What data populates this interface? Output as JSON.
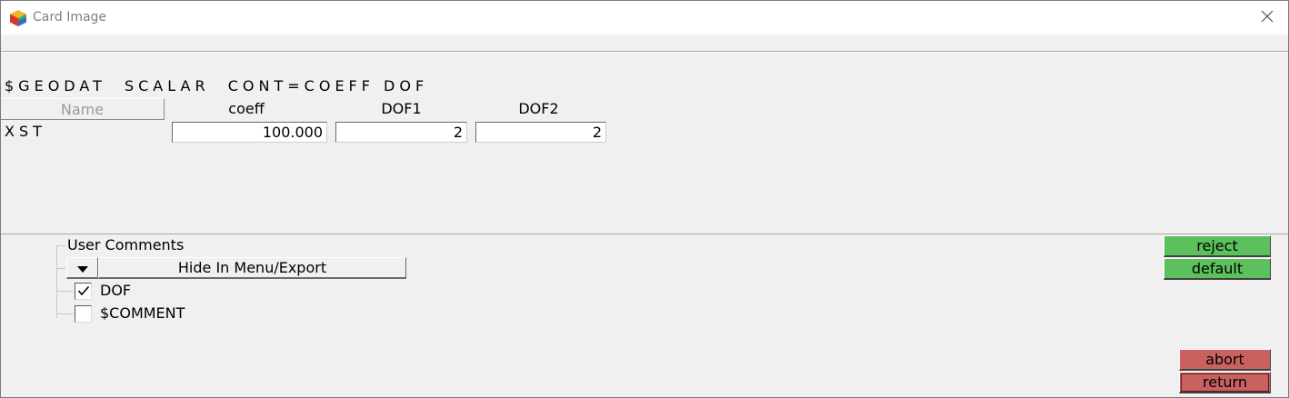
{
  "window": {
    "title": "Card Image",
    "icon": "app-cube-icon",
    "close_icon": "close-icon"
  },
  "card": {
    "header": "$GEODAT  SCALAR  CONT=COEFF DOF",
    "name_header": "Name",
    "columns": [
      "coeff",
      "DOF1",
      "DOF2"
    ],
    "row": {
      "name": "XST",
      "values": [
        "100.000",
        "2",
        "2"
      ]
    }
  },
  "comments": {
    "title": "User Comments",
    "dropdown_icon": "triangle-down-icon",
    "hide_label": "Hide In Menu/Export",
    "items": [
      {
        "label": "DOF",
        "checked": true
      },
      {
        "label": "$COMMENT",
        "checked": false
      }
    ]
  },
  "actions": {
    "reject": "reject",
    "default": "default",
    "abort": "abort",
    "return": "return",
    "colors": {
      "green": "#5cc15c",
      "red": "#c96161"
    }
  }
}
